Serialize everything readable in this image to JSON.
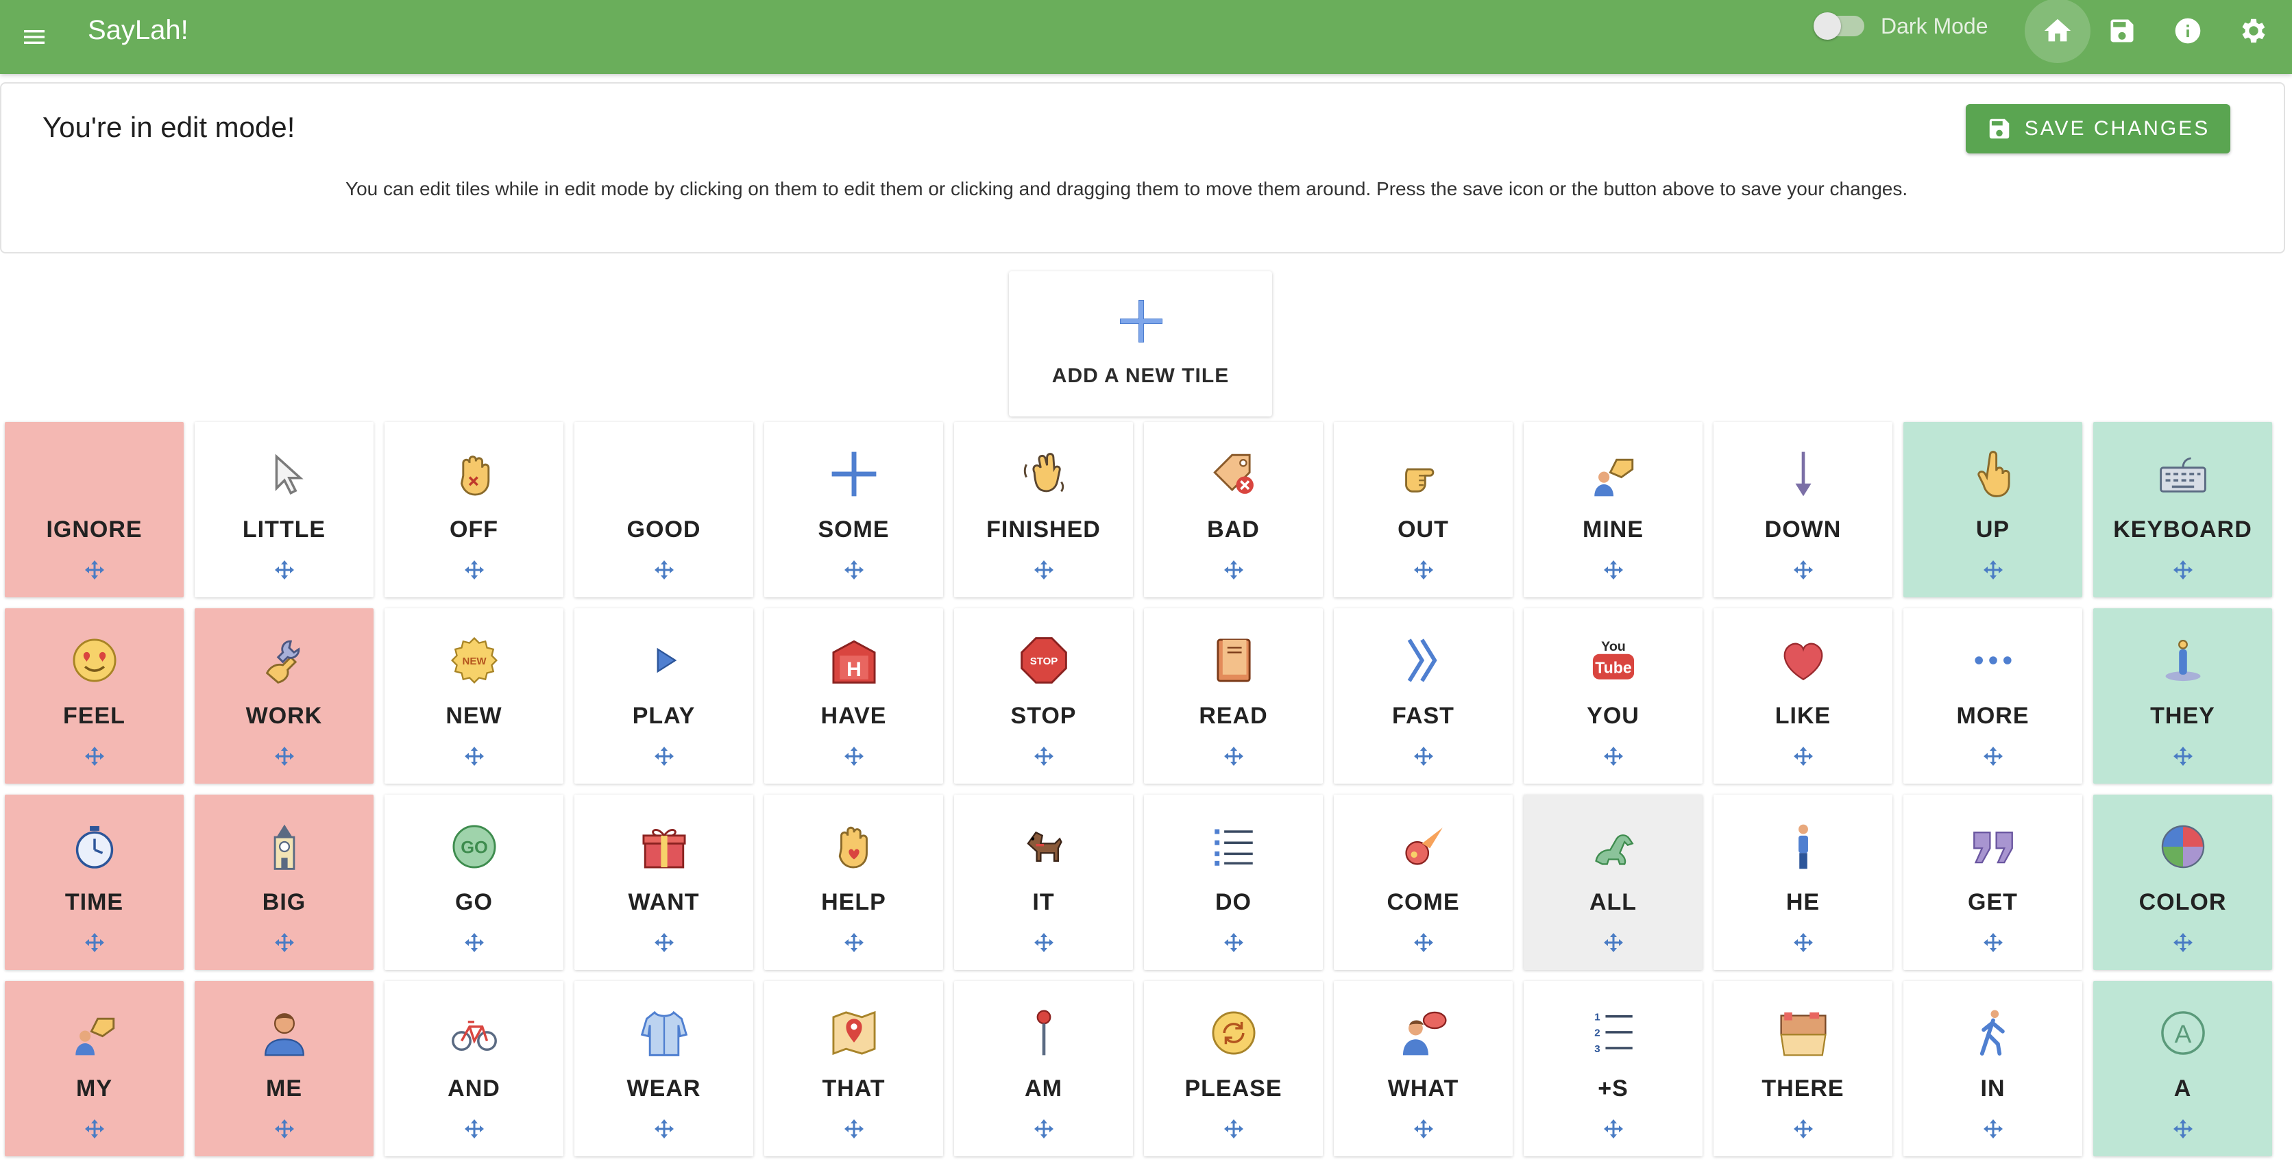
{
  "app": {
    "title": "SayLah!",
    "dark_mode_label": "Dark Mode",
    "colors": {
      "appbar": "#6aae5b",
      "save_button": "#5aa551",
      "tile_red": "#f4b8b3",
      "tile_green": "#bee6d5",
      "tile_gray": "#eeeeee",
      "move_icon": "#4a7cc4"
    }
  },
  "toolbar_icons": [
    "menu-icon",
    "home-icon",
    "save-icon",
    "info-icon",
    "settings-icon"
  ],
  "edit_panel": {
    "title": "You're in edit mode!",
    "description": "You can edit tiles while in edit mode by clicking on them to edit them or clicking and dragging them to move them around. Press the save icon or the button above to save your changes.",
    "save_label": "SAVE CHANGES"
  },
  "add_tile": {
    "label": "ADD A NEW TILE"
  },
  "tiles": [
    {
      "label": "IGNORE",
      "color": "red",
      "icon": "none"
    },
    {
      "label": "LITTLE",
      "color": "white",
      "icon": "cursor-icon"
    },
    {
      "label": "OFF",
      "color": "white",
      "icon": "hand-stop-icon"
    },
    {
      "label": "GOOD",
      "color": "white",
      "icon": "none"
    },
    {
      "label": "SOME",
      "color": "white",
      "icon": "plus-icon"
    },
    {
      "label": "FINISHED",
      "color": "white",
      "icon": "waving-hand-icon"
    },
    {
      "label": "BAD",
      "color": "white",
      "icon": "tag-x-icon"
    },
    {
      "label": "OUT",
      "color": "white",
      "icon": "pointing-hand-icon"
    },
    {
      "label": "MINE",
      "color": "white",
      "icon": "person-hand-icon"
    },
    {
      "label": "DOWN",
      "color": "white",
      "icon": "arrow-down-icon"
    },
    {
      "label": "UP",
      "color": "green",
      "icon": "hand-up-icon"
    },
    {
      "label": "KEYBOARD",
      "color": "green",
      "icon": "keyboard-icon"
    },
    {
      "label": "FEEL",
      "color": "red",
      "icon": "heart-eyes-icon"
    },
    {
      "label": "WORK",
      "color": "red",
      "icon": "wrench-hand-icon"
    },
    {
      "label": "NEW",
      "color": "white",
      "icon": "new-badge-icon"
    },
    {
      "label": "PLAY",
      "color": "white",
      "icon": "play-icon"
    },
    {
      "label": "HAVE",
      "color": "white",
      "icon": "hospital-icon"
    },
    {
      "label": "STOP",
      "color": "white",
      "icon": "stop-sign-icon"
    },
    {
      "label": "READ",
      "color": "white",
      "icon": "book-icon"
    },
    {
      "label": "FAST",
      "color": "white",
      "icon": "double-chevron-icon"
    },
    {
      "label": "YOU",
      "color": "white",
      "icon": "youtube-icon"
    },
    {
      "label": "LIKE",
      "color": "white",
      "icon": "heart-icon"
    },
    {
      "label": "MORE",
      "color": "white",
      "icon": "ellipsis-icon"
    },
    {
      "label": "THEY",
      "color": "green",
      "icon": "person-stand-icon"
    },
    {
      "label": "TIME",
      "color": "red",
      "icon": "stopwatch-icon"
    },
    {
      "label": "BIG",
      "color": "red",
      "icon": "clock-tower-icon"
    },
    {
      "label": "GO",
      "color": "white",
      "icon": "go-badge-icon"
    },
    {
      "label": "WANT",
      "color": "white",
      "icon": "gift-icon"
    },
    {
      "label": "HELP",
      "color": "white",
      "icon": "hand-heart-icon"
    },
    {
      "label": "IT",
      "color": "white",
      "icon": "dog-icon"
    },
    {
      "label": "DO",
      "color": "white",
      "icon": "list-icon"
    },
    {
      "label": "COME",
      "color": "white",
      "icon": "comet-icon"
    },
    {
      "label": "ALL",
      "color": "gray",
      "icon": "dino-icon"
    },
    {
      "label": "HE",
      "color": "white",
      "icon": "man-icon"
    },
    {
      "label": "GET",
      "color": "white",
      "icon": "quote-icon"
    },
    {
      "label": "COLOR",
      "color": "green",
      "icon": "color-wheel-icon"
    },
    {
      "label": "MY",
      "color": "red",
      "icon": "person-hand-icon"
    },
    {
      "label": "ME",
      "color": "red",
      "icon": "person-icon"
    },
    {
      "label": "AND",
      "color": "white",
      "icon": "bicycle-icon"
    },
    {
      "label": "WEAR",
      "color": "white",
      "icon": "shirt-icon"
    },
    {
      "label": "THAT",
      "color": "white",
      "icon": "map-pin-icon"
    },
    {
      "label": "AM",
      "color": "white",
      "icon": "pushpin-icon"
    },
    {
      "label": "PLEASE",
      "color": "white",
      "icon": "refresh-coin-icon"
    },
    {
      "label": "WHAT",
      "color": "white",
      "icon": "person-speech-icon"
    },
    {
      "label": "+S",
      "color": "white",
      "icon": "numbered-list-icon"
    },
    {
      "label": "THERE",
      "color": "white",
      "icon": "street-icon"
    },
    {
      "label": "IN",
      "color": "white",
      "icon": "walking-icon"
    },
    {
      "label": "A",
      "color": "green",
      "icon": "letter-a-icon"
    }
  ]
}
